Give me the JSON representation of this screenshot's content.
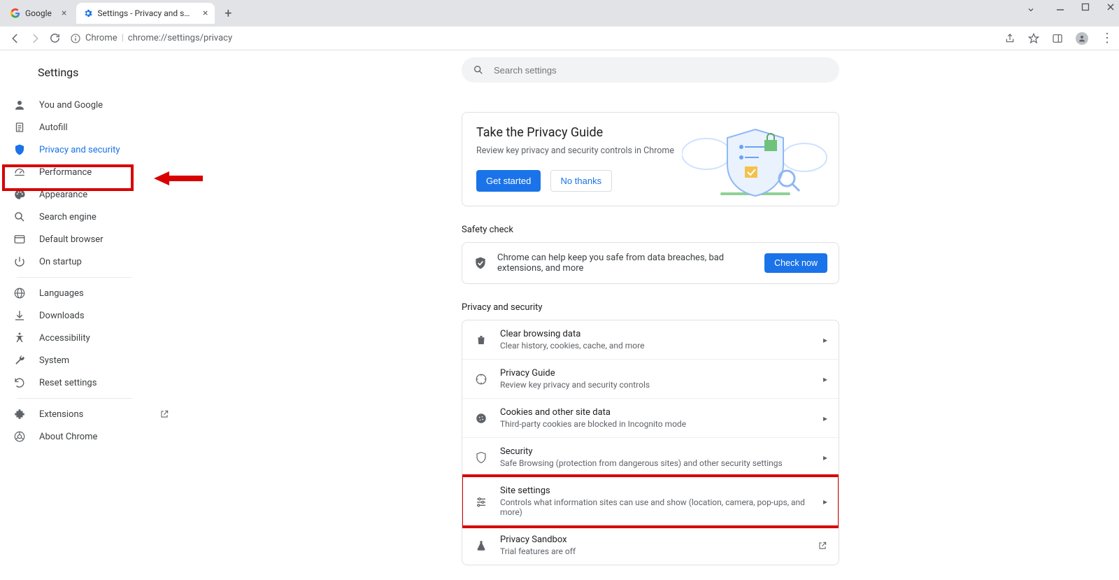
{
  "tabs": {
    "google": "Google",
    "settings": "Settings - Privacy and security"
  },
  "omnibox": {
    "chip": "Chrome",
    "url": "chrome://settings/privacy"
  },
  "brand": "Settings",
  "sidebar": {
    "you": "You and Google",
    "autofill": "Autofill",
    "privacy": "Privacy and security",
    "performance": "Performance",
    "appearance": "Appearance",
    "search": "Search engine",
    "default": "Default browser",
    "startup": "On startup",
    "languages": "Languages",
    "downloads": "Downloads",
    "accessibility": "Accessibility",
    "system": "System",
    "reset": "Reset settings",
    "extensions": "Extensions",
    "about": "About Chrome"
  },
  "search": {
    "placeholder": "Search settings"
  },
  "guide": {
    "title": "Take the Privacy Guide",
    "sub": "Review key privacy and security controls in Chrome",
    "primary": "Get started",
    "secondary": "No thanks"
  },
  "safety": {
    "label": "Safety check",
    "text": "Chrome can help keep you safe from data breaches, bad extensions, and more",
    "button": "Check now"
  },
  "ps": {
    "label": "Privacy and security",
    "rows": {
      "clear": {
        "t": "Clear browsing data",
        "s": "Clear history, cookies, cache, and more"
      },
      "guide": {
        "t": "Privacy Guide",
        "s": "Review key privacy and security controls"
      },
      "cookies": {
        "t": "Cookies and other site data",
        "s": "Third-party cookies are blocked in Incognito mode"
      },
      "security": {
        "t": "Security",
        "s": "Safe Browsing (protection from dangerous sites) and other security settings"
      },
      "site": {
        "t": "Site settings",
        "s": "Controls what information sites can use and show (location, camera, pop-ups, and more)"
      },
      "sandbox": {
        "t": "Privacy Sandbox",
        "s": "Trial features are off"
      }
    }
  }
}
